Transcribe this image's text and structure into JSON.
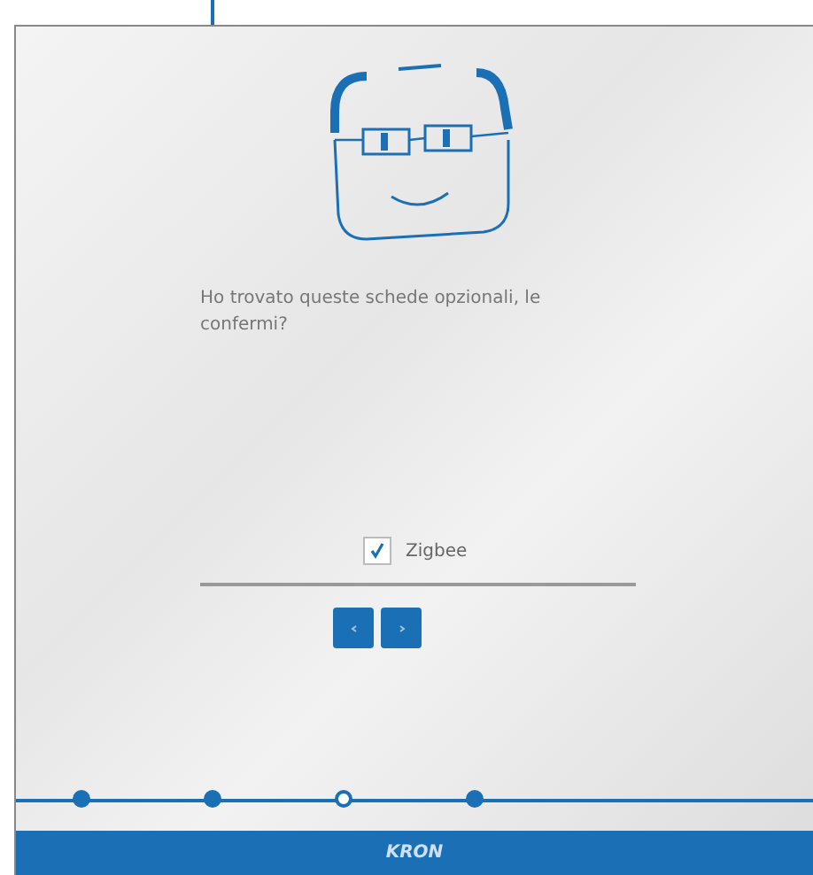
{
  "prompt": "Ho trovato queste schede opzionali, le confermi?",
  "options": [
    {
      "label": "Zigbee",
      "checked": true
    }
  ],
  "buttons": [
    {
      "kind": "back"
    },
    {
      "kind": "next"
    }
  ],
  "steps": [
    {
      "selected": false
    },
    {
      "selected": false
    },
    {
      "selected": true
    },
    {
      "selected": false
    }
  ],
  "footer": {
    "logo": "KRON"
  }
}
